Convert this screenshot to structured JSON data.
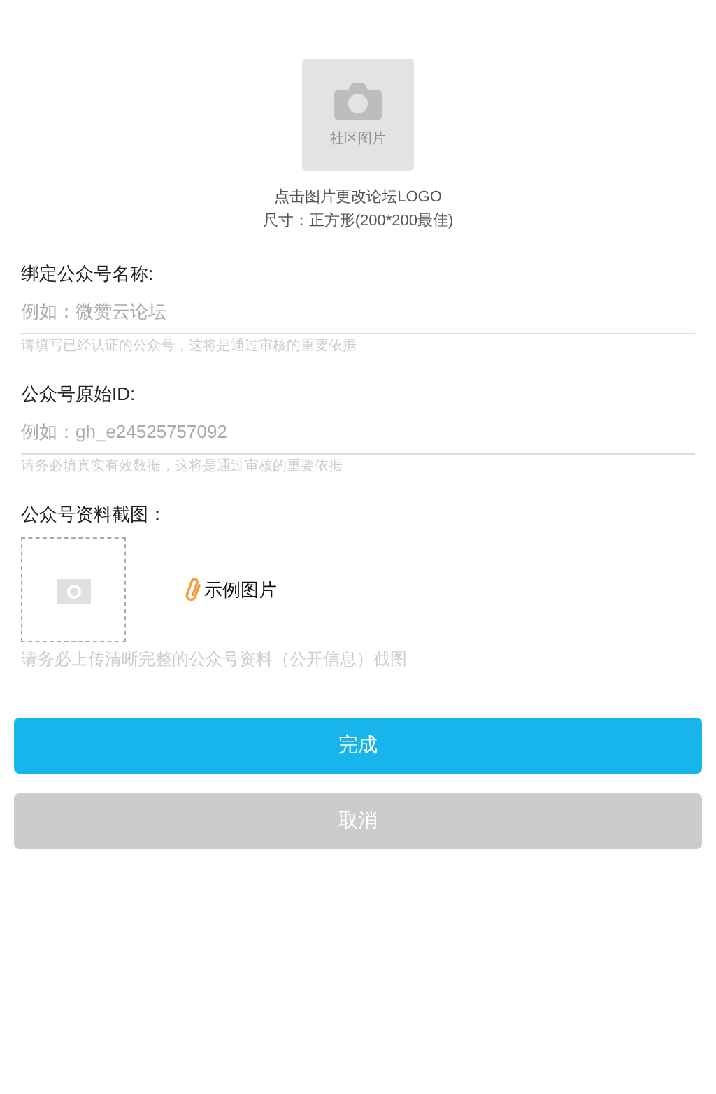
{
  "logo": {
    "label": "社区图片",
    "caption": "点击图片更改论坛LOGO",
    "size_hint": "尺寸：正方形(200*200最佳)"
  },
  "fields": [
    {
      "label": "绑定公众号名称:",
      "placeholder": "例如：微赞云论坛",
      "hint": "请填写已经认证的公众号，这将是通过审核的重要依据"
    },
    {
      "label": "公众号原始ID:",
      "placeholder": "例如：gh_e24525757092",
      "hint": "请务必填真实有效数据，这将是通过审核的重要依据"
    }
  ],
  "screenshot": {
    "label": "公众号资料截图：",
    "example_link": "示例图片",
    "hint": "请务必上传清晰完整的公众号资料（公开信息）截图"
  },
  "buttons": [
    {
      "label": "完成",
      "kind": "primary"
    },
    {
      "label": "取消",
      "kind": "secondary"
    }
  ]
}
